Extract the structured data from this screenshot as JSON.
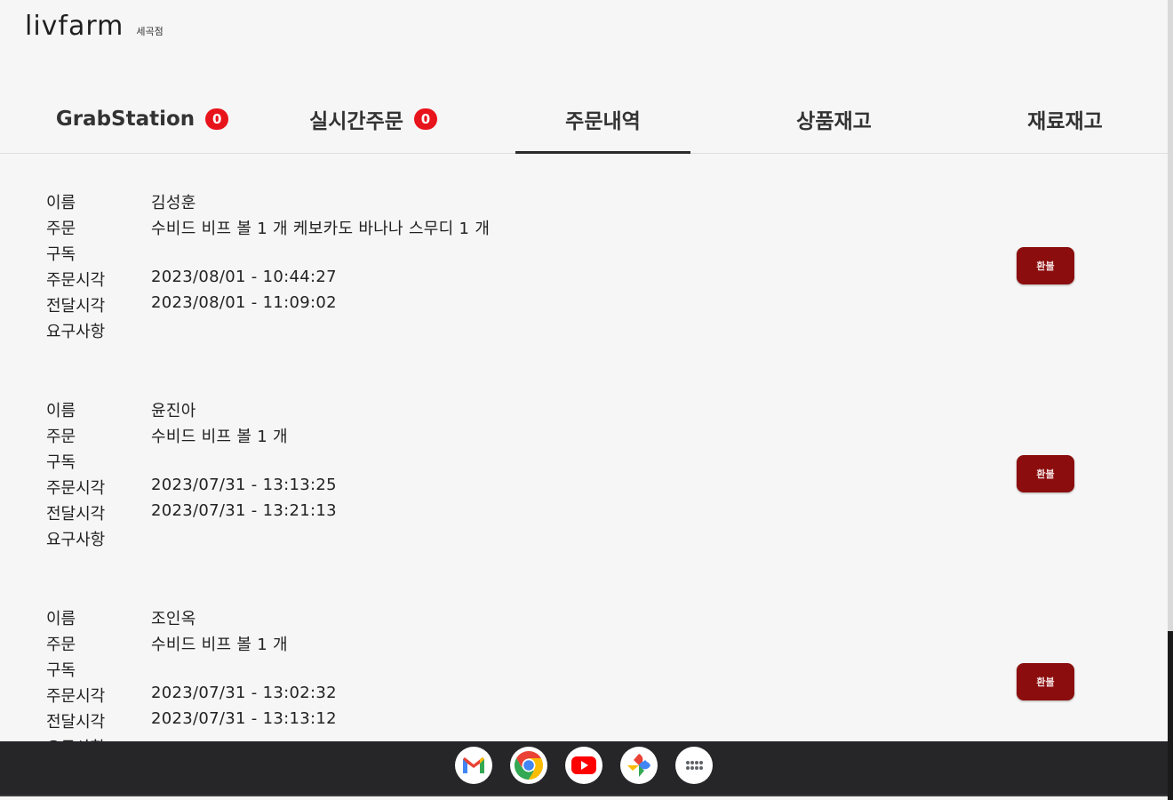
{
  "brand": {
    "logo": "livfarm",
    "store": "세곡점"
  },
  "tabs": [
    {
      "label": "GrabStation",
      "badge": "0"
    },
    {
      "label": "실시간주문",
      "badge": "0"
    },
    {
      "label": "주문내역"
    },
    {
      "label": "상품재고"
    },
    {
      "label": "재료재고"
    }
  ],
  "field_labels": {
    "name": "이름",
    "order": "주문",
    "subscription": "구독",
    "order_time": "주문시각",
    "delivery_time": "전달시각",
    "requests": "요구사항"
  },
  "orders": [
    {
      "name": "김성훈",
      "items": "수비드 비프 볼 1 개  케보카도 바나나 스무디 1 개",
      "subscription": "",
      "order_time": "2023/08/01 - 10:44:27",
      "delivery_time": "2023/08/01 - 11:09:02",
      "requests": "",
      "action": "환불"
    },
    {
      "name": "윤진아",
      "items": "수비드 비프 볼 1 개",
      "subscription": "",
      "order_time": "2023/07/31 - 13:13:25",
      "delivery_time": "2023/07/31 - 13:21:13",
      "requests": "",
      "action": "환불"
    },
    {
      "name": "조인옥",
      "items": "수비드 비프 볼 1 개",
      "subscription": "",
      "order_time": "2023/07/31 - 13:02:32",
      "delivery_time": "2023/07/31 - 13:13:12",
      "requests": "",
      "action": "환불"
    }
  ],
  "dock": [
    "gmail-icon",
    "chrome-icon",
    "youtube-icon",
    "photos-icon",
    "launcher-icon"
  ],
  "colors": {
    "badge": "#e8141b",
    "refund_button": "#8b0d0d",
    "taskbar": "#262629"
  }
}
